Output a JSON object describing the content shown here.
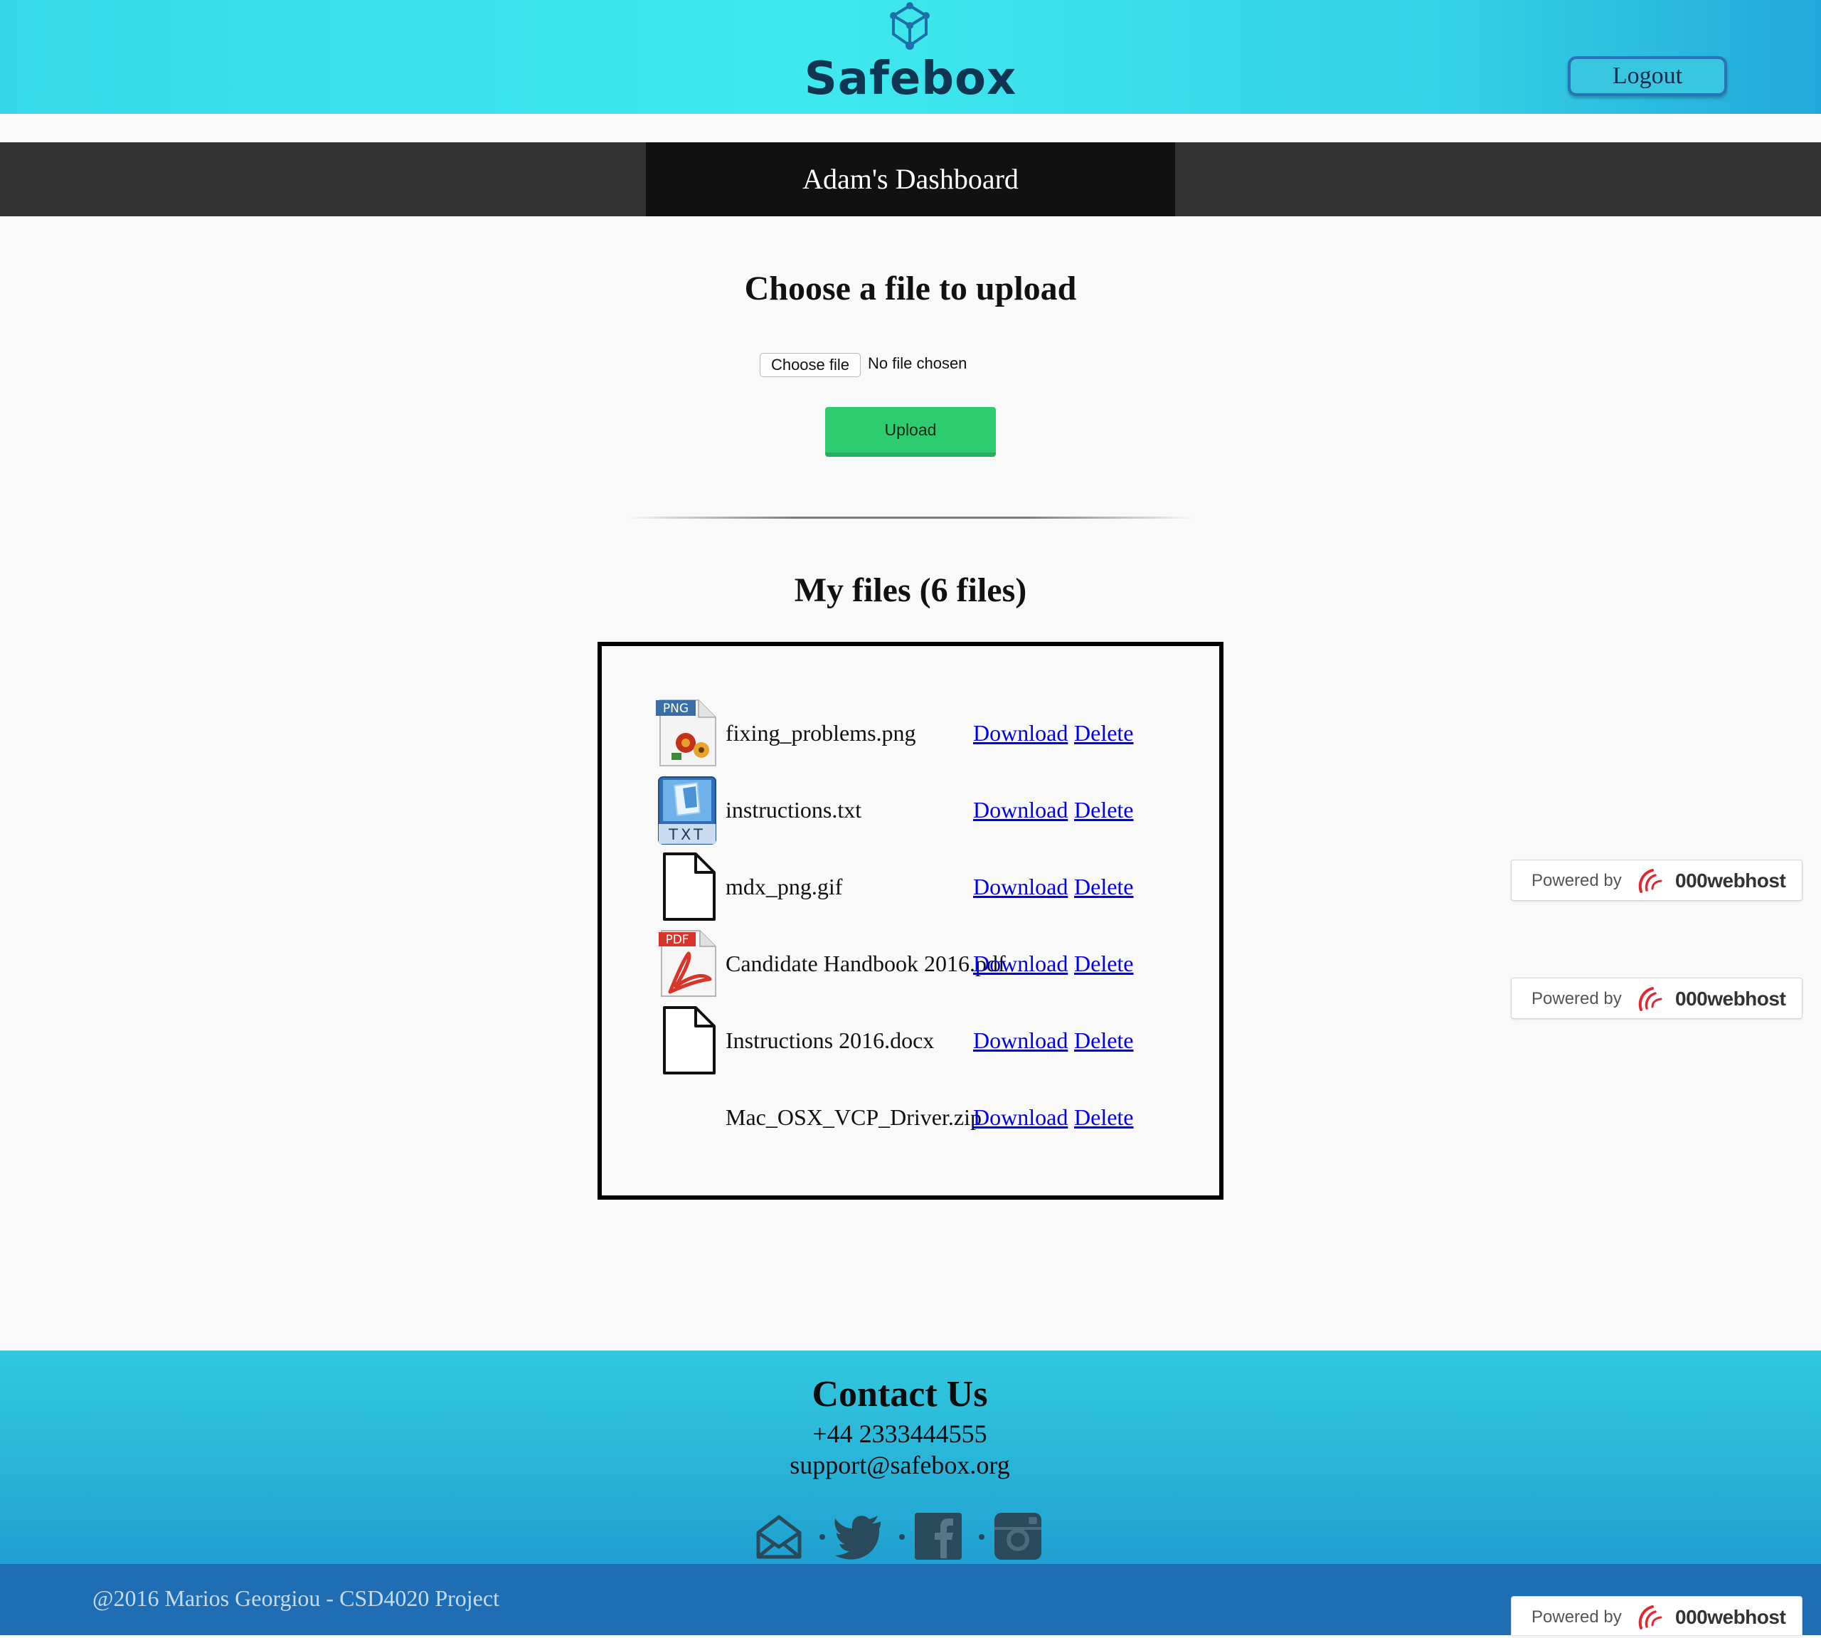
{
  "header": {
    "logo_text": "Safebox",
    "logout_label": "Logout"
  },
  "dashboard": {
    "title": "Adam's Dashboard"
  },
  "upload": {
    "heading": "Choose a file to upload",
    "choose_label": "Choose file",
    "no_file_label": "No file chosen",
    "upload_label": "Upload"
  },
  "files": {
    "heading": "My files (6 files)",
    "items": [
      {
        "name": "fixing_problems.png",
        "icon": "png-file-icon",
        "download": "Download",
        "delete": "Delete"
      },
      {
        "name": "instructions.txt",
        "icon": "txt-file-icon",
        "download": "Download",
        "delete": "Delete"
      },
      {
        "name": "mdx_png.gif",
        "icon": "blank-file-icon",
        "download": "Download",
        "delete": "Delete"
      },
      {
        "name": "Candidate Handbook 2016.pdf",
        "icon": "pdf-file-icon",
        "download": "Download",
        "delete": "Delete"
      },
      {
        "name": "Instructions 2016.docx",
        "icon": "blank-file-icon",
        "download": "Download",
        "delete": "Delete"
      },
      {
        "name": "Mac_OSX_VCP_Driver.zip",
        "icon": "none",
        "download": "Download",
        "delete": "Delete"
      }
    ]
  },
  "powered": {
    "by": "Powered by",
    "host": "000webhost"
  },
  "footer": {
    "title": "Contact Us",
    "phone": "+44 2333444555",
    "email": "support@safebox.org",
    "social": [
      "mail-icon",
      "twitter-icon",
      "facebook-icon",
      "instagram-icon"
    ],
    "copyright": "@2016 Marios Georgiou - CSD4020 Project"
  },
  "colors": {
    "header_cyan": "#3ee9ee",
    "dark_bar": "#333333",
    "title_block": "#111111",
    "upload_green": "#2ecc71",
    "link_blue": "#0000ee",
    "footer_blue": "#1f6db3"
  }
}
